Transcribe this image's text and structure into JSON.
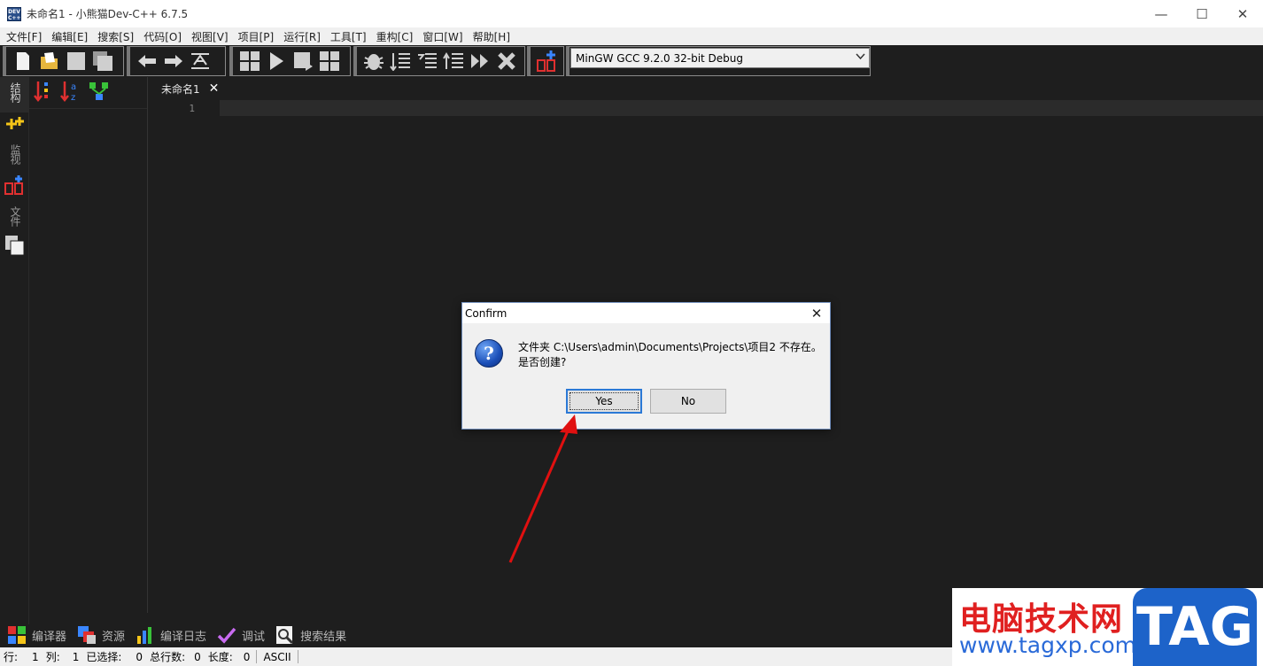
{
  "window": {
    "icon_text": "DEV C++",
    "title": "未命名1 - 小熊猫Dev-C++ 6.7.5",
    "minimize": "—",
    "maximize": "☐",
    "close": "✕"
  },
  "menu": [
    "文件[F]",
    "编辑[E]",
    "搜索[S]",
    "代码[O]",
    "视图[V]",
    "项目[P]",
    "运行[R]",
    "工具[T]",
    "重构[C]",
    "窗口[W]",
    "帮助[H]"
  ],
  "toolbar": {
    "compiler_selected": "MinGW GCC 9.2.0 32-bit Debug"
  },
  "left_strip": {
    "tabs": [
      "结构",
      "监视",
      "文件"
    ]
  },
  "editor": {
    "tab_label": "未命名1",
    "tab_close": "✕",
    "line_numbers": [
      "1"
    ],
    "content": ""
  },
  "bottom_tabs": [
    "编译器",
    "资源",
    "编译日志",
    "调试",
    "搜索结果"
  ],
  "status": {
    "row_label": "行:",
    "row_value": "1",
    "col_label": "列:",
    "col_value": "1",
    "selected_label": "已选择:",
    "selected_value": "0",
    "lines_label": "总行数:",
    "lines_value": "0",
    "length_label": "长度:",
    "length_value": "0",
    "encoding": "ASCII"
  },
  "dialog": {
    "title": "Confirm",
    "close": "✕",
    "icon": "?",
    "message_line1": "文件夹 C:\\Users\\admin\\Documents\\Projects\\项目2 不存在。",
    "message_line2": "是否创建?",
    "yes_label": "Yes",
    "no_label": "No"
  },
  "watermark": {
    "line1": "电脑技术网",
    "line2": "www.tagxp.com",
    "logo": "TAG"
  },
  "colors": {
    "background": "#1e1e1e",
    "current_line": "#2b2b2b",
    "dialog_bg": "#f0f0f0",
    "accent_blue": "#2b79d6",
    "annotation_arrow": "#e01010"
  }
}
